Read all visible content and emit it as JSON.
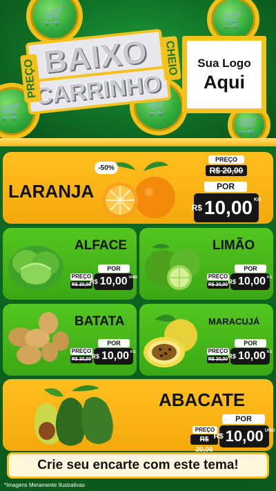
{
  "header": {
    "banner_line1": "BAIXO",
    "banner_line2": "CARRINHO",
    "tag_left": "PREÇO",
    "tag_right": "CHEIO",
    "logo_line1": "Sua Logo",
    "logo_line2": "Aqui"
  },
  "products": [
    {
      "name": "LARANJA",
      "discount": "-50%",
      "preco_label": "PREÇO",
      "old_price": "R$ 20,00",
      "por_label": "POR",
      "currency": "R$",
      "price": "10,00",
      "unit": "KG"
    },
    {
      "name": "ALFACE",
      "preco_label": "PREÇO",
      "old_price": "R$ 20,00",
      "por_label": "POR",
      "currency": "R$",
      "price": "10,00",
      "unit": "UNID"
    },
    {
      "name": "LIMÃO",
      "preco_label": "PREÇO",
      "old_price": "R$ 20,00",
      "por_label": "POR",
      "currency": "R$",
      "price": "10,00",
      "unit": "KG"
    },
    {
      "name": "BATATA",
      "preco_label": "PREÇO",
      "old_price": "R$ 20,00",
      "por_label": "POR",
      "currency": "R$",
      "price": "10,00",
      "unit": "KG"
    },
    {
      "name": "MARACUJÁ",
      "preco_label": "PREÇO",
      "old_price": "R$ 20,00",
      "por_label": "POR",
      "currency": "R$",
      "price": "10,00",
      "unit": "KG"
    },
    {
      "name": "ABACATE",
      "preco_label": "PREÇO",
      "old_price": "R$ 20,00",
      "por_label": "POR",
      "currency": "R$",
      "price": "10,00",
      "unit": "UNID"
    }
  ],
  "cta": "Crie seu encarte com este tema!",
  "disclaimer": "*Imagens Meramente Ilustrativas",
  "colors": {
    "green": "#0f6a22",
    "gold": "#f4c21c",
    "orange_card": "#f4a90c",
    "green_card": "#44b318",
    "price_bg": "#161616"
  }
}
